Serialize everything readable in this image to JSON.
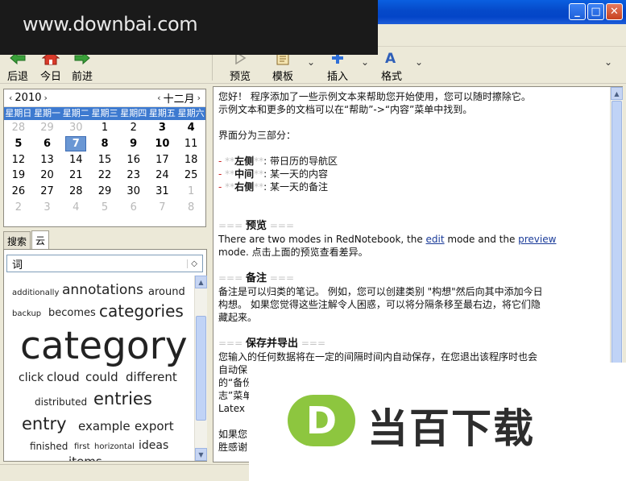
{
  "watermark": {
    "text": "www.downbai.com"
  },
  "window_buttons": {
    "minimize": "_",
    "maximize": "□",
    "close": "✕"
  },
  "toolbar": {
    "back": "后退",
    "today": "今日",
    "forward": "前进",
    "preview": "预览",
    "template": "模板",
    "insert": "插入",
    "format": "格式",
    "dropdown_glyph": "⌄"
  },
  "calendar": {
    "year": "2010",
    "month": "十二月",
    "prev_arrow": "‹",
    "next_arrow": "›",
    "weekdays": [
      "星期日",
      "星期一",
      "星期二",
      "星期三",
      "星期四",
      "星期五",
      "星期六"
    ],
    "days": [
      [
        "28",
        "29",
        "30",
        "1",
        "2",
        "3",
        "4"
      ],
      [
        "5",
        "6",
        "7",
        "8",
        "9",
        "10",
        "11"
      ],
      [
        "12",
        "13",
        "14",
        "15",
        "16",
        "17",
        "18"
      ],
      [
        "19",
        "20",
        "21",
        "22",
        "23",
        "24",
        "25"
      ],
      [
        "26",
        "27",
        "28",
        "29",
        "30",
        "31",
        "1"
      ],
      [
        "2",
        "3",
        "4",
        "5",
        "6",
        "7",
        "8"
      ]
    ],
    "selected": "7"
  },
  "tabs": {
    "search": "搜索",
    "cloud": "云"
  },
  "cloud": {
    "category_select": "词",
    "words": [
      "additionally",
      "annotations",
      "around",
      "backup",
      "becomes",
      "categories",
      "category",
      "click",
      "cloud",
      "could",
      "different",
      "distributed",
      "entries",
      "entry",
      "example",
      "export",
      "finished",
      "first",
      "horizontal",
      "ideas",
      "items"
    ]
  },
  "editor": {
    "line1": "您好！ 程序添加了一些示例文本来帮助您开始使用，您可以随时擦除它。",
    "line2": "示例文本和更多的文档可以在“帮助”->“内容”菜单中找到。",
    "line3": "界面分为三部分：",
    "list": [
      {
        "dash": "- ",
        "stars": "**",
        "label": "左侧",
        "text": ": 带日历的导航区"
      },
      {
        "dash": "- ",
        "stars": "**",
        "label": "中间",
        "text": ": 某一天的内容"
      },
      {
        "dash": "- ",
        "stars": "**",
        "label": "右侧",
        "text": ": 某一天的备注"
      }
    ],
    "heading_marks": "===",
    "preview_title": "预览",
    "preview_p1a": "There are two modes in RedNotebook, the ",
    "preview_edit": "edit",
    "preview_p1b": " mode and the ",
    "preview_preview": "preview",
    "preview_p2": "mode. 点击上面的预览查看差异。",
    "notes_title": "备注",
    "notes_p1": "备注是可以归类的笔记。 例如，您可以创建类别 \"构想\"然后向其中添加今日",
    "notes_p2": "构想。 如果您觉得这些注解令人困惑，可以将分隔条移至最右边，将它们隐",
    "notes_p3": "藏起来。",
    "save_title": "保存并导出",
    "save_p1": "您输入的任何数据将在一定的间隔时间内自动保存，在您退出该程序时也会",
    "save_p2": "自动保",
    "save_p3": "的“备份",
    "save_p4": "志”菜单",
    "save_p5": "Latex ·",
    "tail_p1": "如果您",
    "tail_p2": "胜感谢"
  },
  "logo": {
    "mark": "D",
    "text": "当百下载"
  }
}
